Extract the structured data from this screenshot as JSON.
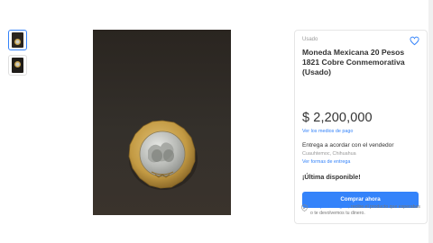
{
  "product": {
    "condition": "Usado",
    "title": "Moneda Mexicana 20 Pesos 1821 Cobre Conmemorativa (Usado)",
    "price": "$ 2,200,000",
    "payment_link": "Ver los medios de pago",
    "shipping": "Entrega a acordar con el vendedor",
    "location": "Cuauhtemoc, Chihuahua",
    "shipping_link": "Ver formas de entrega",
    "stock": "¡Última disponible!",
    "buy_label": "Comprar ahora"
  },
  "protection": {
    "brand": "Compra Protegida",
    "text": ", recibe el producto que esperabas o te devolvemos tu dinero."
  },
  "icons": {
    "favorite": "heart-icon",
    "protection": "shield-icon"
  },
  "colors": {
    "accent": "#3483fa",
    "coin_rim": "#c8a24a",
    "coin_center": "#c9cbc6"
  }
}
